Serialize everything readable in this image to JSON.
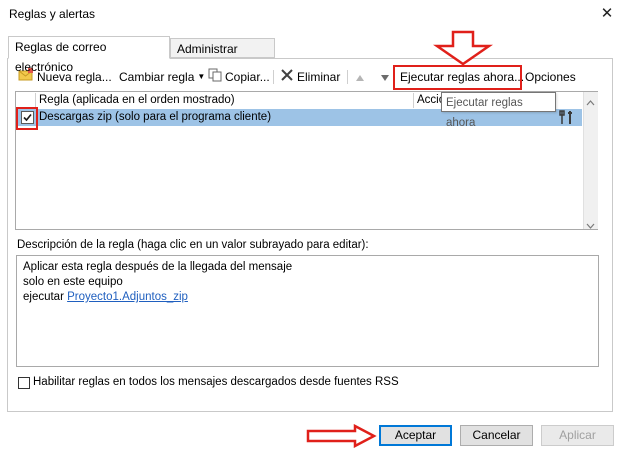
{
  "window": {
    "title": "Reglas y alertas",
    "close_glyph": "✕"
  },
  "tabs": [
    {
      "label": "Reglas de correo electrónico",
      "active": true
    },
    {
      "label": "Administrar alertas",
      "active": false
    }
  ],
  "toolbar": {
    "new_rule": "Nueva regla...",
    "change_rule": "Cambiar regla",
    "copy": "Copiar...",
    "delete": "Eliminar",
    "run_rules": "Ejecutar reglas ahora...",
    "options": "Opciones"
  },
  "rules_table": {
    "col_rule": "Regla (aplicada en el orden mostrado)",
    "col_actions": "Accio",
    "rows": [
      {
        "checked": true,
        "label": "Descargas zip  (solo para el programa cliente)"
      }
    ]
  },
  "tooltip": "Ejecutar reglas ahora",
  "description": {
    "label": "Descripción de la regla (haga clic en un valor subrayado para editar):",
    "line1": "Aplicar esta regla después de la llegada del mensaje",
    "line2": "solo en este equipo",
    "line3_prefix": "ejecutar ",
    "line3_link": "Proyecto1.Adjuntos_zip"
  },
  "rss": {
    "checked": false,
    "label": "Habilitar reglas en todos los mensajes descargados desde fuentes RSS"
  },
  "buttons": {
    "ok": "Aceptar",
    "cancel": "Cancelar",
    "apply": "Aplicar"
  },
  "colors": {
    "highlight": "#9dc3e6",
    "annotation_red": "#e0201a",
    "link": "#1f5fbf"
  }
}
